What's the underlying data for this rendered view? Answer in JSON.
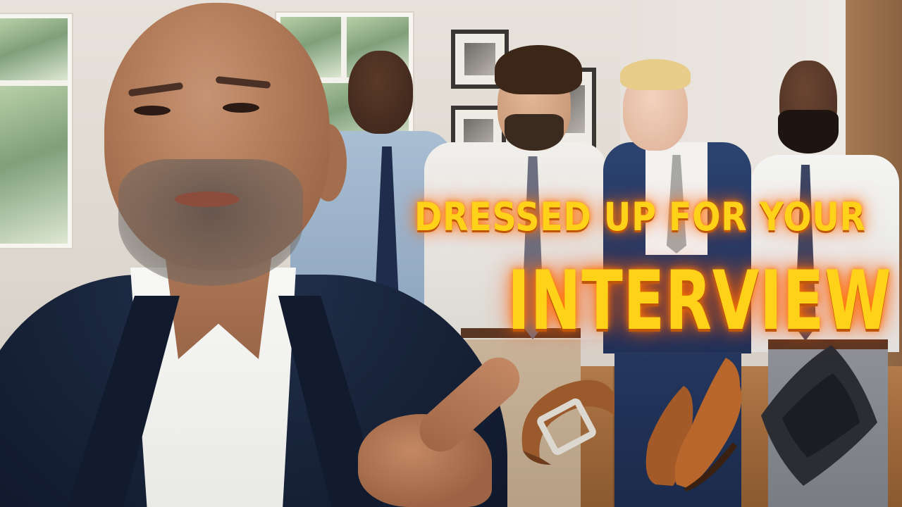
{
  "thumbnail": {
    "headline_line1": "DRESSED UP FOR YOUR",
    "headline_line2": "INTERVIEW",
    "colors": {
      "headline_fill": "#ffd21a",
      "headline_glow": "#ff7a00",
      "suit_navy": "#172238",
      "wall": "#e7e2db",
      "floor": "#a06a3c"
    },
    "icons": [
      "belt-icon",
      "dress-shoes-icon",
      "hat-icon",
      "pointing-hand-icon"
    ]
  }
}
